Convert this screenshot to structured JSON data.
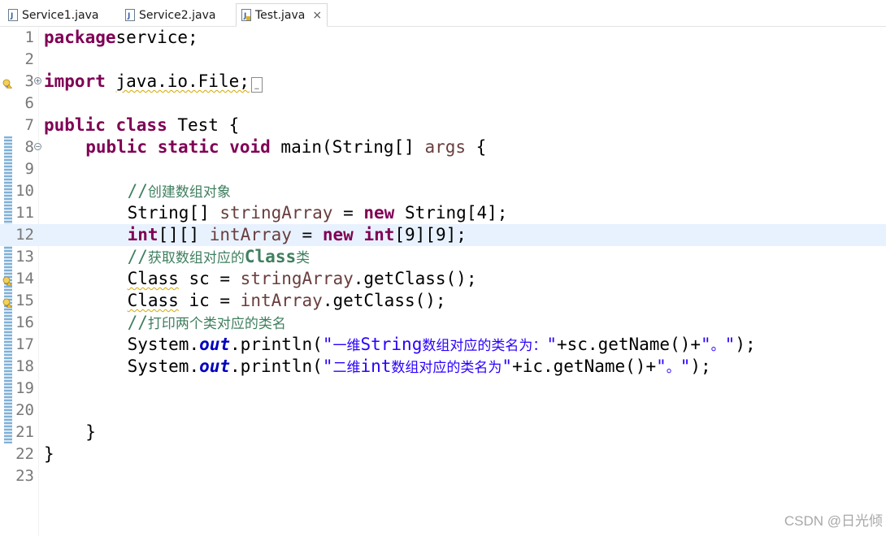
{
  "tabs": [
    {
      "label": "Service1.java",
      "active": false
    },
    {
      "label": "Service2.java",
      "active": false
    },
    {
      "label": "Test.java",
      "active": true,
      "close": "×"
    }
  ],
  "editor": {
    "current_line": 12,
    "lines": [
      {
        "num": "1",
        "segments": [
          [
            "kw",
            "package"
          ],
          [
            "",
            "service;"
          ]
        ]
      },
      {
        "num": "2",
        "segments": []
      },
      {
        "num": "3",
        "fold": "+",
        "marker": "warning-lightbulb",
        "segments": [
          [
            "kw",
            "import"
          ],
          [
            "",
            " "
          ],
          [
            "warn",
            "java.io.File;"
          ],
          [
            "box",
            "…"
          ]
        ]
      },
      {
        "num": "6",
        "segments": []
      },
      {
        "num": "7",
        "segments": [
          [
            "kw",
            "public class"
          ],
          [
            "",
            " Test {"
          ]
        ]
      },
      {
        "num": "8",
        "fold": "−",
        "segments": [
          [
            "",
            " "
          ],
          [
            "kw",
            "public static void"
          ],
          [
            "",
            " main(String[] "
          ],
          [
            "var",
            "args"
          ],
          [
            "",
            " {"
          ]
        ]
      },
      {
        "num": "9",
        "segments": []
      },
      {
        "num": "10",
        "segments": [
          [
            "",
            " "
          ],
          [
            "cmt",
            "//"
          ],
          [
            "cmtcjk",
            "创建数组对象"
          ]
        ]
      },
      {
        "num": "11",
        "segments": [
          [
            "",
            " String[] "
          ],
          [
            "var",
            "stringArray"
          ],
          [
            "",
            " = "
          ],
          [
            "kw",
            "new"
          ],
          [
            "",
            " String[4];"
          ]
        ]
      },
      {
        "num": "12",
        "segments": [
          [
            "",
            " "
          ],
          [
            "kw",
            "int"
          ],
          [
            "",
            "[][] "
          ],
          [
            "var",
            "intArray"
          ],
          [
            "",
            " = "
          ],
          [
            "kw",
            "new"
          ],
          [
            "",
            " "
          ],
          [
            "kw",
            "int"
          ],
          [
            "",
            "[9][9];"
          ]
        ]
      },
      {
        "num": "13",
        "segments": [
          [
            "",
            " "
          ],
          [
            "cmt",
            "//"
          ],
          [
            "cmtcjk",
            "获取数组对应的"
          ],
          [
            "cmtb",
            "Class"
          ],
          [
            "cmtcjk",
            "类"
          ]
        ]
      },
      {
        "num": "14",
        "marker": "warning-lightbulb",
        "segments": [
          [
            "",
            " "
          ],
          [
            "warn",
            "Class"
          ],
          [
            "",
            " sc = "
          ],
          [
            "var",
            "stringArray"
          ],
          [
            "",
            ".getClass();"
          ]
        ]
      },
      {
        "num": "15",
        "marker": "warning-lightbulb",
        "segments": [
          [
            "",
            " "
          ],
          [
            "warn",
            "Class"
          ],
          [
            "",
            " ic = "
          ],
          [
            "var",
            "intArray"
          ],
          [
            "",
            ".getClass();"
          ]
        ]
      },
      {
        "num": "16",
        "segments": [
          [
            "",
            " "
          ],
          [
            "cmt",
            "//"
          ],
          [
            "cmtcjk",
            "打印两个类对应的类名"
          ]
        ]
      },
      {
        "num": "17",
        "segments": [
          [
            "",
            " System."
          ],
          [
            "fld",
            "out"
          ],
          [
            "",
            ".println("
          ],
          [
            "str",
            "\""
          ],
          [
            "strcjk",
            "一维"
          ],
          [
            "str",
            "String"
          ],
          [
            "strcjk",
            "数组对应的类名为："
          ],
          [
            "str",
            "\""
          ],
          [
            "",
            "+sc.getName()+"
          ],
          [
            "str",
            "\""
          ],
          [
            "strcjk",
            "。"
          ],
          [
            "str",
            "\""
          ],
          [
            "",
            ");"
          ]
        ]
      },
      {
        "num": "18",
        "segments": [
          [
            "",
            " System."
          ],
          [
            "fld",
            "out"
          ],
          [
            "",
            ".println("
          ],
          [
            "str",
            "\""
          ],
          [
            "strcjk",
            "二维"
          ],
          [
            "str",
            "int"
          ],
          [
            "strcjk",
            "数组对应的类名为"
          ],
          [
            "str",
            "\""
          ],
          [
            "",
            "+ic.getName()+"
          ],
          [
            "str",
            "\""
          ],
          [
            "strcjk",
            "。"
          ],
          [
            "str",
            "\""
          ],
          [
            "",
            ");"
          ]
        ]
      },
      {
        "num": "19",
        "segments": []
      },
      {
        "num": "20",
        "segments": []
      },
      {
        "num": "21",
        "segments": [
          [
            "",
            " }"
          ]
        ]
      },
      {
        "num": "22",
        "segments": [
          [
            "",
            "}"
          ]
        ]
      },
      {
        "num": "23",
        "segments": []
      }
    ]
  },
  "watermark": "CSDN @日光倾"
}
